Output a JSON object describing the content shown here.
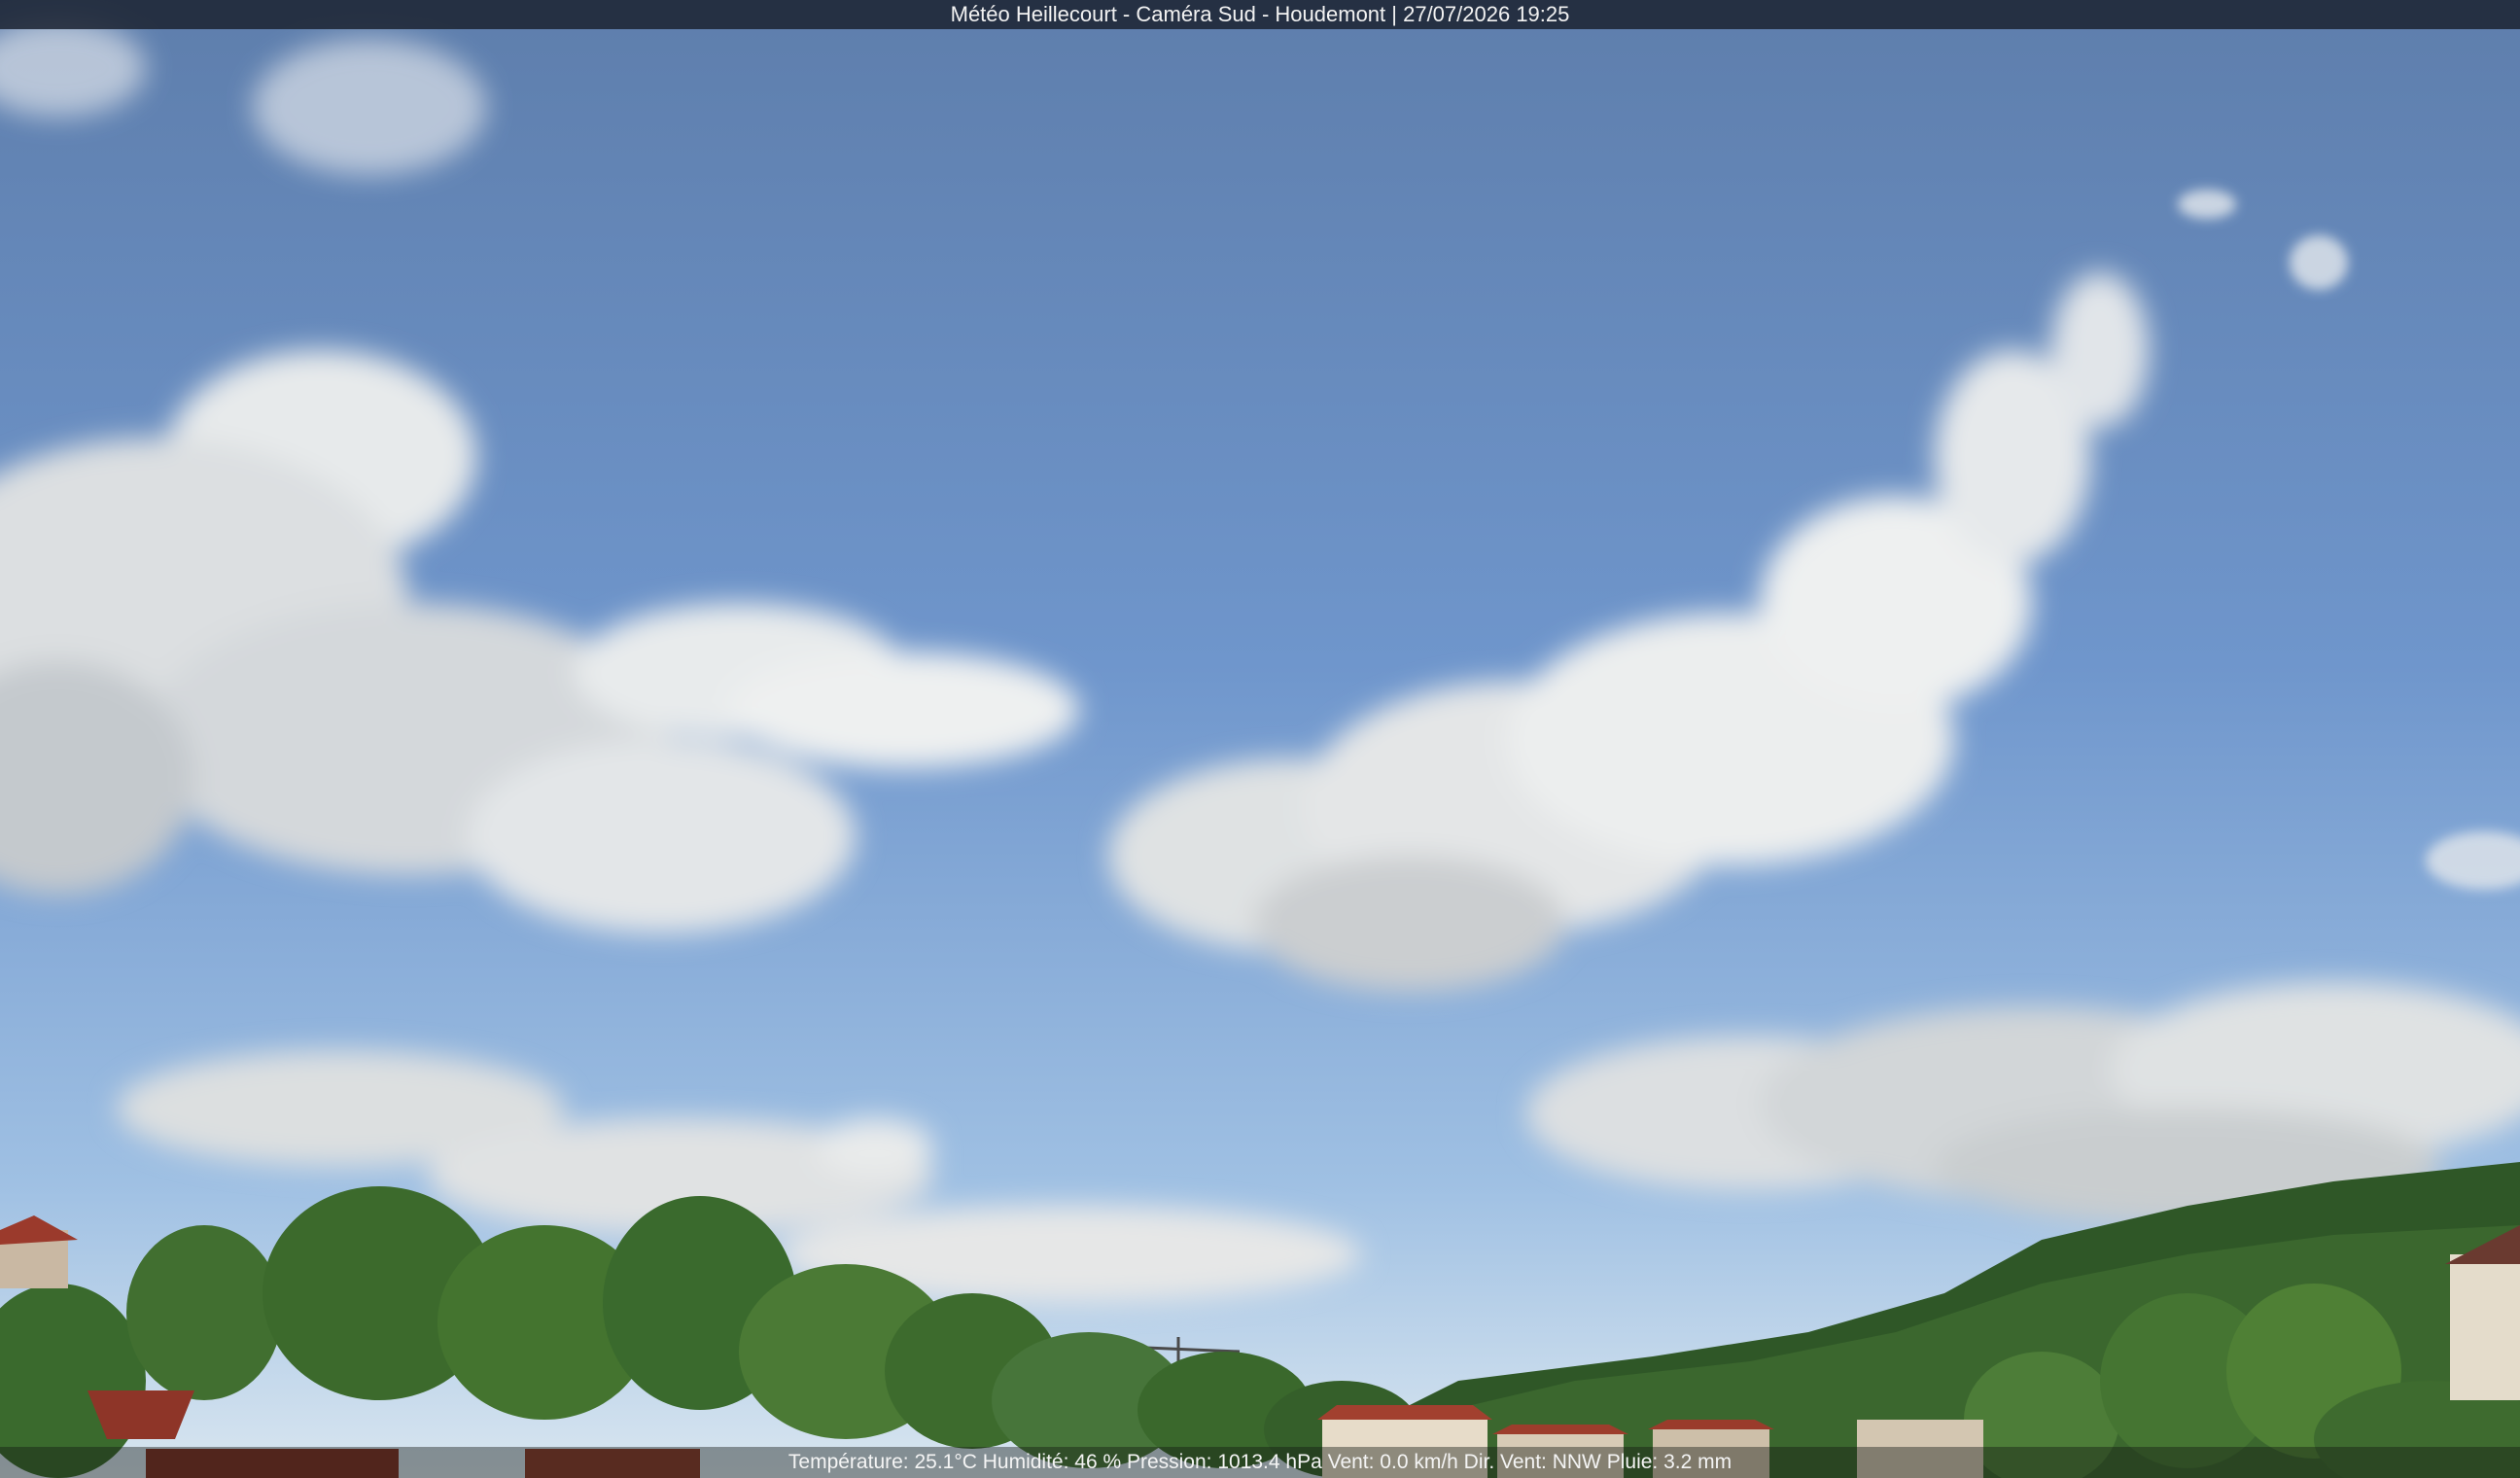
{
  "overlay": {
    "title": "Météo Heillecourt - Caméra Sud - Houdemont | 27/07/2026 19:25",
    "weather": "Température: 25.1°C  Humidité: 46 % Pression: 1013.4 hPa Vent: 0.0 km/h Dir. Vent: NNW Pluie: 3.2 mm"
  },
  "scene": {
    "sky_top_color": "#5f7fac",
    "sky_bottom_color": "#cfe0ef",
    "cloud_color": "#e9ecec",
    "cloud_shadow_color": "#b9bdbf",
    "tree_color": "#3f6b2e",
    "hill_color": "#2f5727",
    "roof_color": "#9b3a2c"
  }
}
